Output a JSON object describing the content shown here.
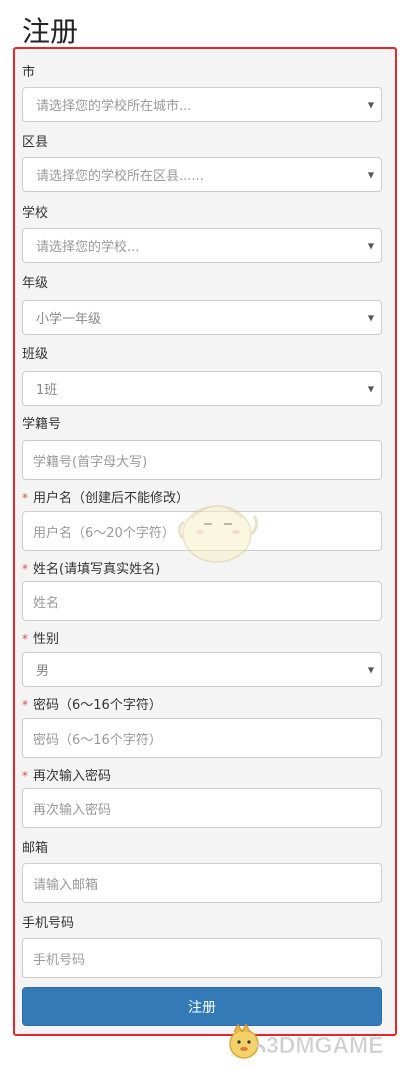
{
  "page": {
    "title": "注册"
  },
  "form": {
    "fields": [
      {
        "label": "市",
        "required": false,
        "type": "select",
        "value": "请选择您的学校所在城市..."
      },
      {
        "label": "区县",
        "required": false,
        "type": "select",
        "value": "请选择您的学校所在区县......"
      },
      {
        "label": "学校",
        "required": false,
        "type": "select",
        "value": "请选择您的学校..."
      },
      {
        "label": "年级",
        "required": false,
        "type": "select",
        "value": "小学一年级"
      },
      {
        "label": "班级",
        "required": false,
        "type": "select",
        "value": "1班"
      },
      {
        "label": "学籍号",
        "required": false,
        "type": "input",
        "placeholder": "学籍号(首字母大写)"
      },
      {
        "label": "用户名（创建后不能修改）",
        "required": true,
        "type": "input",
        "placeholder": "用户名（6～20个字符）"
      },
      {
        "label": "姓名(请填写真实姓名)",
        "required": true,
        "type": "input",
        "placeholder": "姓名"
      },
      {
        "label": "性别",
        "required": true,
        "type": "select",
        "value": "男"
      },
      {
        "label": "密码（6～16个字符）",
        "required": true,
        "type": "input",
        "placeholder": "密码（6～16个字符）"
      },
      {
        "label": "再次输入密码",
        "required": true,
        "type": "input",
        "placeholder": "再次输入密码"
      },
      {
        "label": "邮箱",
        "required": false,
        "type": "input",
        "placeholder": "请输入邮箱"
      },
      {
        "label": "手机号码",
        "required": false,
        "type": "input",
        "placeholder": "手机号码"
      }
    ],
    "required_marker": "*",
    "submit_label": "注册",
    "caret": "▼"
  },
  "watermark": {
    "text": "3DMGAME"
  },
  "colors": {
    "frame_border": "#e5262a",
    "button": "#337ab7",
    "required": "#d9534f"
  }
}
